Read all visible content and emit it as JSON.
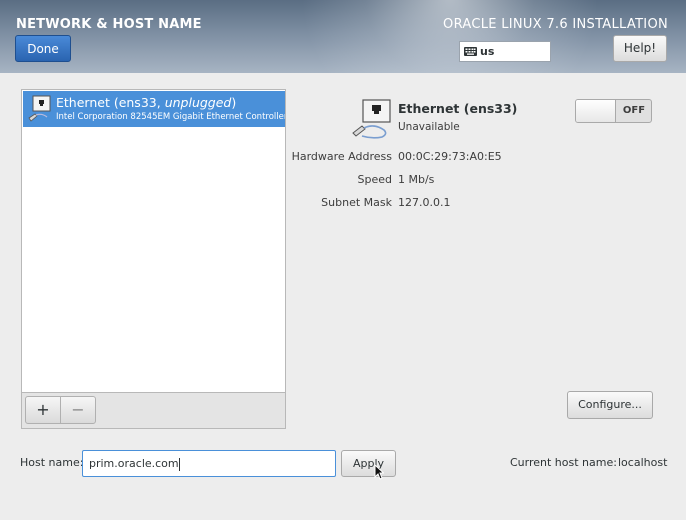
{
  "header": {
    "title": "NETWORK & HOST NAME",
    "done_label": "Done",
    "install_title": "ORACLE LINUX 7.6 INSTALLATION",
    "keyboard_layout": "us",
    "help_label": "Help!"
  },
  "device_list": {
    "items": [
      {
        "name_prefix": "Ethernet (ens33, ",
        "name_state": "unplugged",
        "name_suffix": ")",
        "description": "Intel Corporation 82545EM Gigabit Ethernet Controller (",
        "icon": "ethernet-icon"
      }
    ],
    "add_label": "+",
    "remove_label": "−"
  },
  "detail": {
    "name": "Ethernet (ens33)",
    "status": "Unavailable",
    "toggle_state": "OFF",
    "properties": [
      {
        "label": "Hardware Address",
        "value": "00:0C:29:73:A0:E5"
      },
      {
        "label": "Speed",
        "value": "1 Mb/s"
      },
      {
        "label": "Subnet Mask",
        "value": "127.0.0.1"
      }
    ],
    "configure_label": "Configure..."
  },
  "hostname": {
    "label": "Host name:",
    "value": "prim.oracle.com",
    "apply_label": "Apply",
    "current_label": "Current host name:",
    "current_value": "localhost"
  },
  "colors": {
    "selection": "#4a90d9",
    "done_button": "#2a64b0",
    "header": "#7d8ea2"
  }
}
